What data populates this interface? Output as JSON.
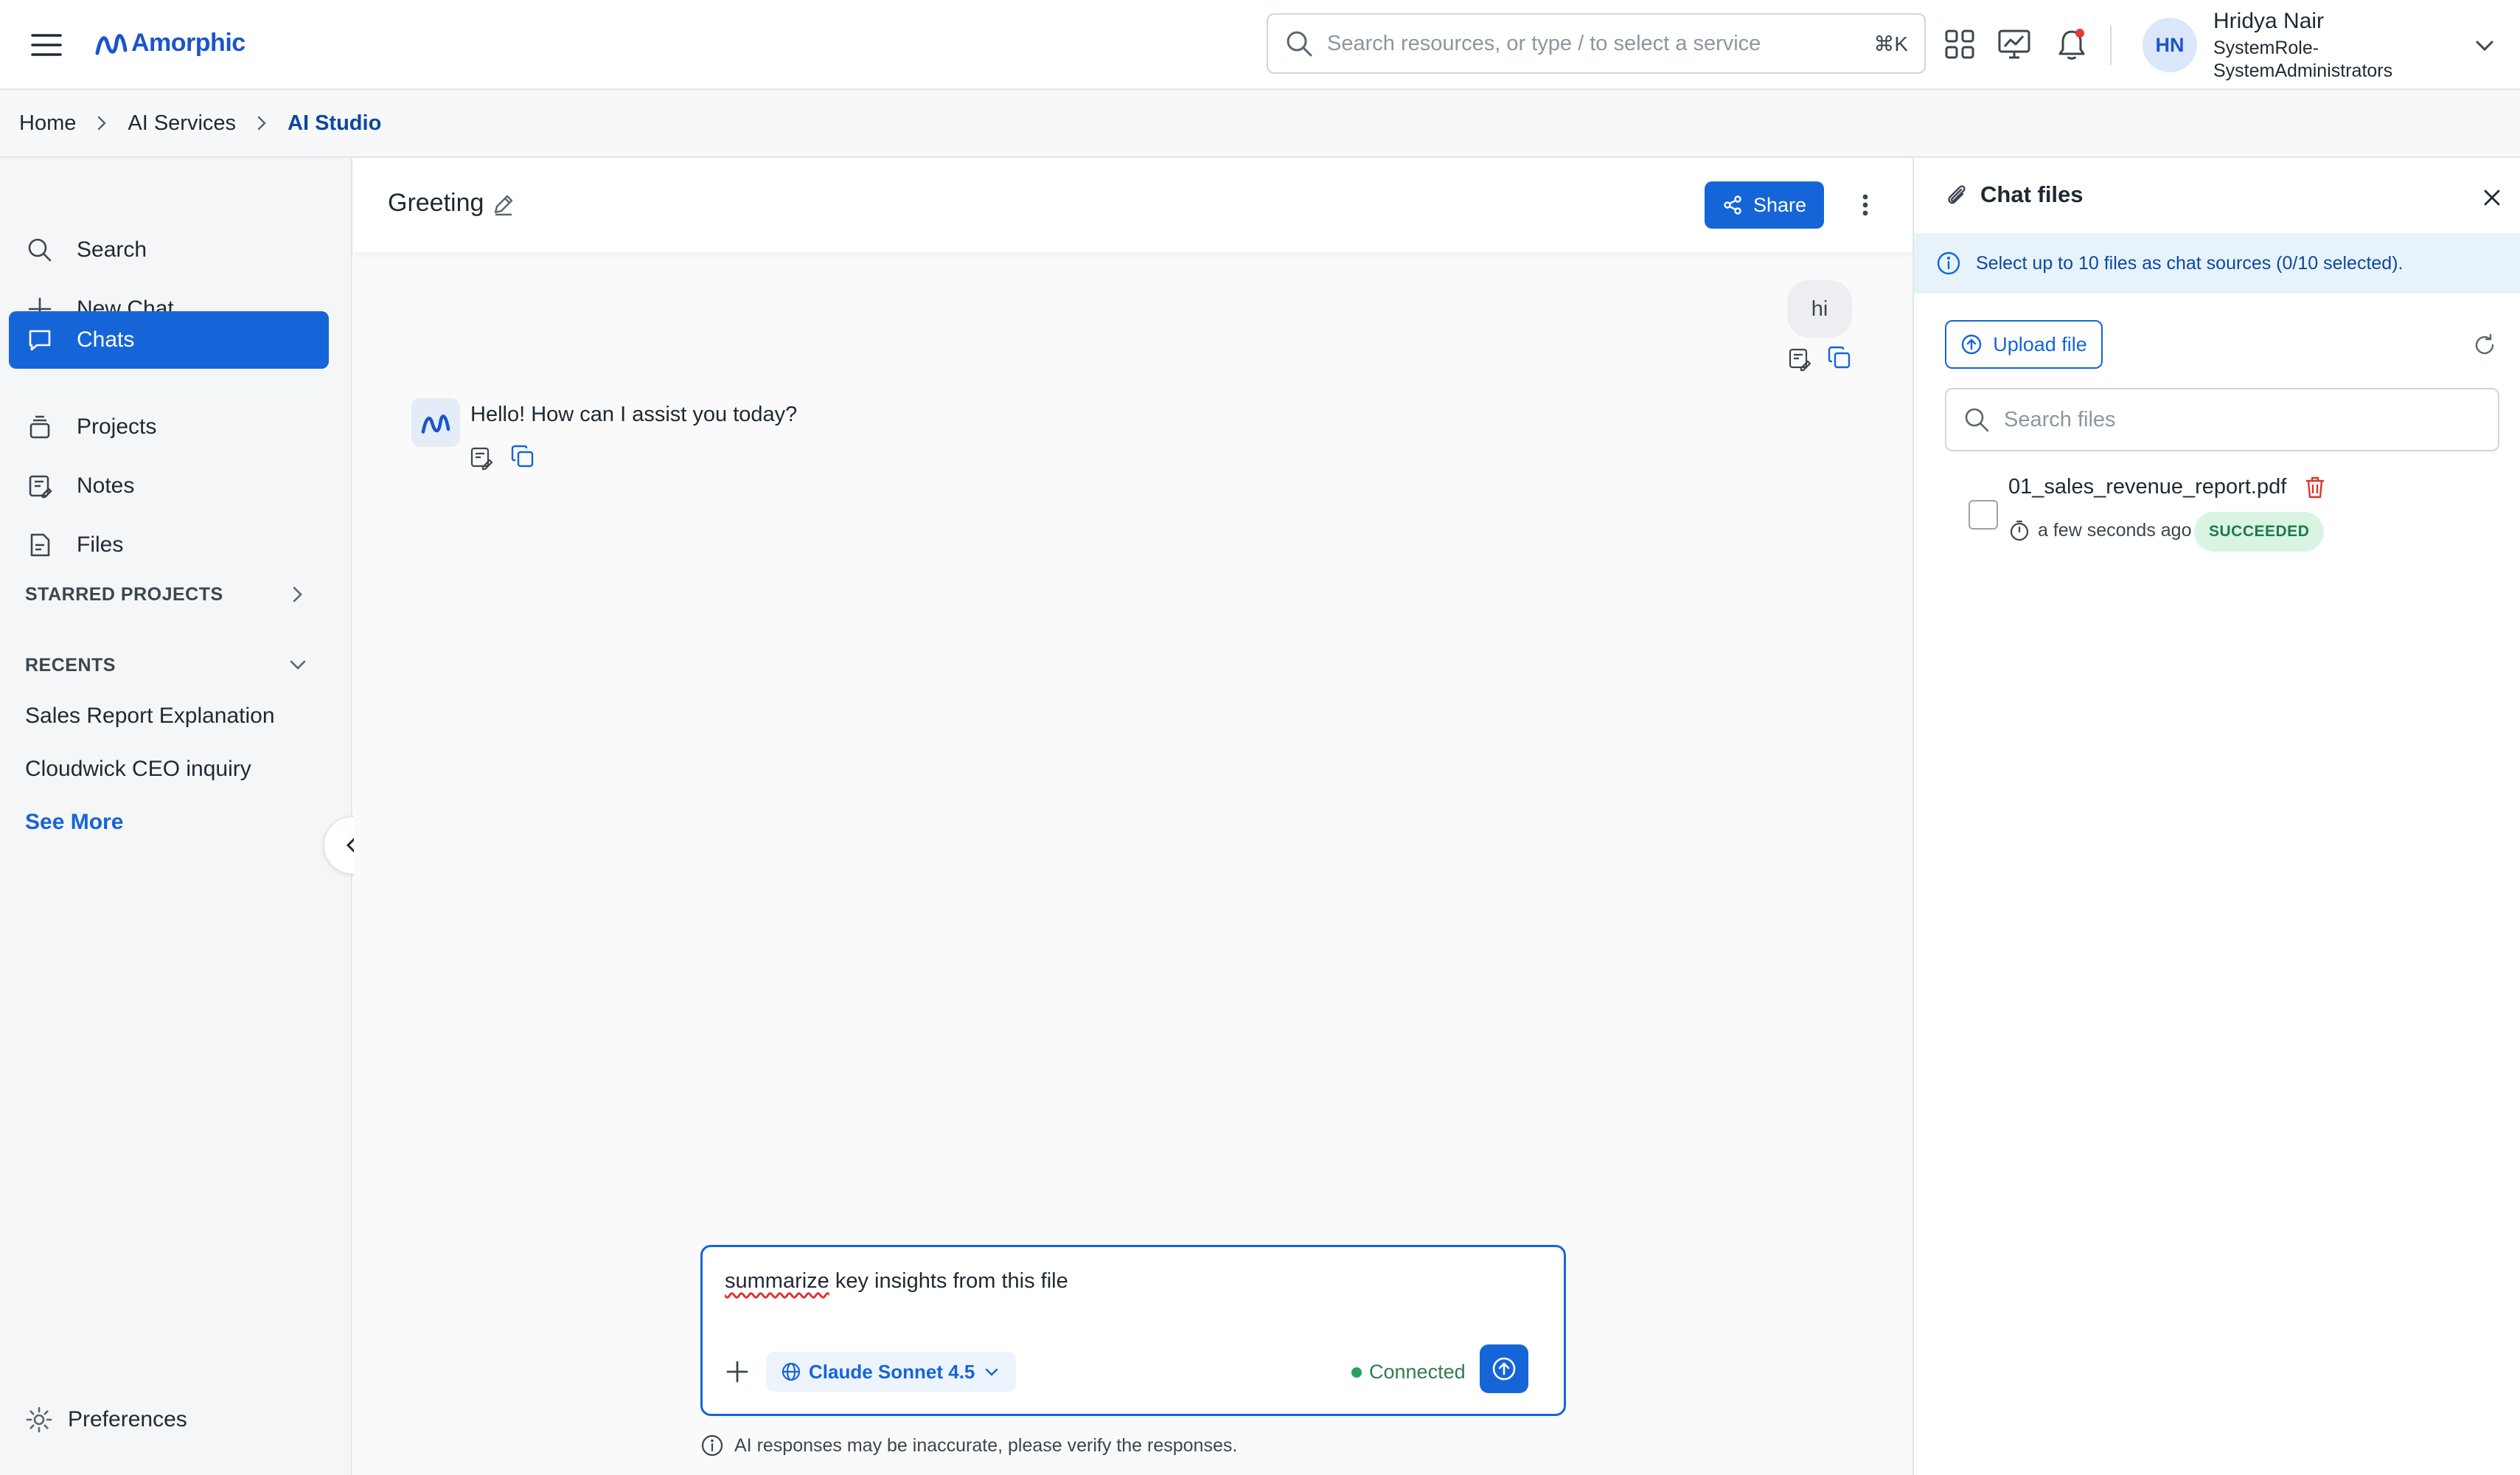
{
  "app": {
    "logo_text": "Amorphic"
  },
  "search": {
    "placeholder": "Search resources, or type / to select a service",
    "shortcut": "⌘K"
  },
  "user": {
    "initials": "HN",
    "name": "Hridya Nair",
    "role": "SystemRole-SystemAdministrators"
  },
  "breadcrumb": [
    "Home",
    "AI Services",
    "AI Studio"
  ],
  "sidebar": {
    "items": [
      {
        "label": "Search",
        "icon": "search-icon"
      },
      {
        "label": "New Chat",
        "icon": "plus-icon"
      },
      {
        "label": "Chats",
        "icon": "chat-icon",
        "active": true
      },
      {
        "label": "Projects",
        "icon": "stack-icon"
      },
      {
        "label": "Notes",
        "icon": "note-icon"
      },
      {
        "label": "Files",
        "icon": "file-icon"
      }
    ],
    "starred_title": "STARRED PROJECTS",
    "recents_title": "RECENTS",
    "recents": [
      "Sales Report Explanation",
      "Cloudwick CEO inquiry"
    ],
    "see_more": "See More",
    "preferences": "Preferences"
  },
  "chat": {
    "title": "Greeting",
    "share_label": "Share",
    "messages": [
      {
        "role": "user",
        "text": "hi"
      },
      {
        "role": "assistant",
        "text": "Hello! How can I assist you today?"
      }
    ],
    "composer": {
      "value_first_word": "summarize",
      "value_rest": " key insights from this file",
      "model": "Claude Sonnet 4.5",
      "status": "Connected"
    },
    "disclaimer": "AI responses may be inaccurate, please verify the responses."
  },
  "files_panel": {
    "title": "Chat files",
    "info": "Select up to 10 files as chat sources (0/10 selected).",
    "upload_label": "Upload file",
    "search_placeholder": "Search files",
    "files": [
      {
        "name": "01_sales_revenue_report.pdf",
        "time": "a few seconds ago",
        "status": "SUCCEEDED"
      }
    ]
  },
  "colors": {
    "primary": "#1565d8",
    "success_bg": "#d9f4e3",
    "success_text": "#1e7a45",
    "info_bg": "#e6f3fb"
  }
}
